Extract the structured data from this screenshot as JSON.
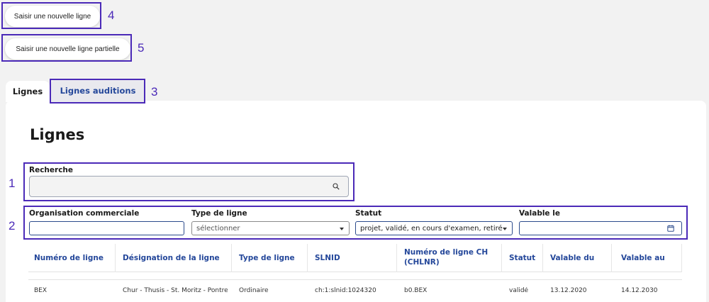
{
  "actions": {
    "new_line_label": "Saisir une nouvelle ligne",
    "new_partial_line_label": "Saisir une nouvelle ligne partielle"
  },
  "tabs": [
    {
      "label": "Lignes",
      "active": true
    },
    {
      "label": "Lignes auditions",
      "active": false
    }
  ],
  "page_title": "Lignes",
  "search": {
    "label": "Recherche",
    "value": "",
    "icon": "search-icon"
  },
  "filters": {
    "organisation": {
      "label": "Organisation commerciale",
      "value": ""
    },
    "type": {
      "label": "Type de ligne",
      "value": "sélectionner"
    },
    "statut": {
      "label": "Statut",
      "value": "projet, validé, en cours d'examen, retiré"
    },
    "valable": {
      "label": "Valable le",
      "value": "",
      "icon": "calendar-icon"
    }
  },
  "table": {
    "columns": [
      "Numéro de ligne",
      "Désignation de la ligne",
      "Type de ligne",
      "SLNID",
      "Numéro de ligne CH (CHLNR)",
      "Statut",
      "Valable du",
      "Valable au"
    ],
    "rows": [
      [
        "BEX",
        "Chur - Thusis - St. Moritz - Pontresi...",
        "Ordinaire",
        "ch:1:slnid:1024320",
        "b0.BEX",
        "validé",
        "13.12.2020",
        "14.12.2030"
      ]
    ]
  },
  "annotations": {
    "n1": "1",
    "n2": "2",
    "n3": "3",
    "n4": "4",
    "n5": "5"
  },
  "colors": {
    "annotation": "#4b2ab8",
    "header_text": "#24479a",
    "input_border": "#2c4b8c"
  }
}
